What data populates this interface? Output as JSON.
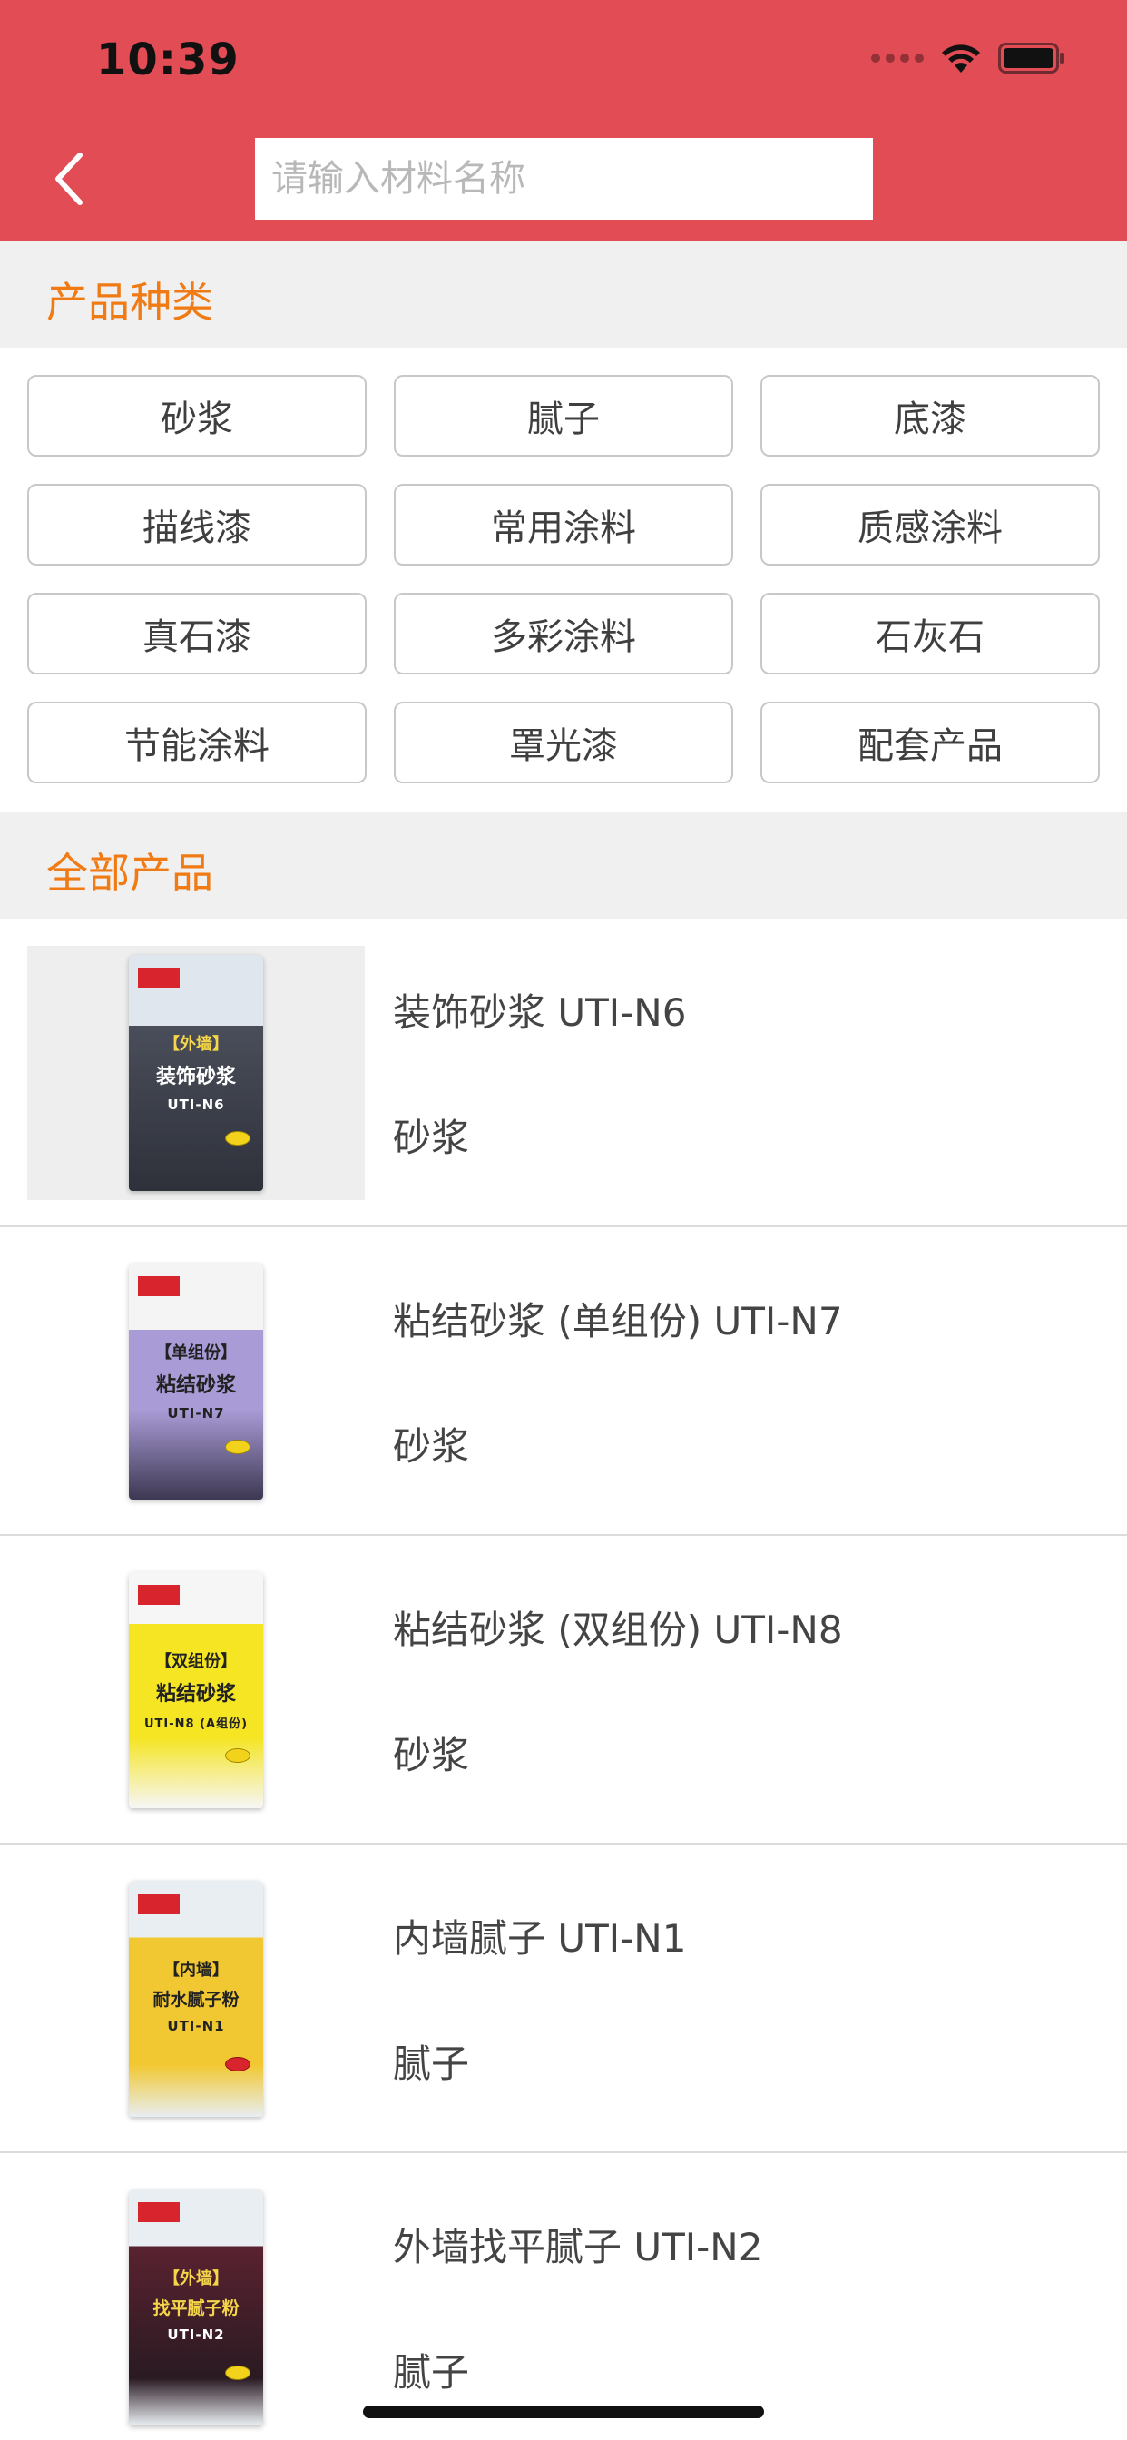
{
  "status_bar": {
    "time": "10:39"
  },
  "header": {
    "search_placeholder": "请输入材料名称"
  },
  "categories_section": {
    "title": "产品种类",
    "items": [
      "砂浆",
      "腻子",
      "底漆",
      "描线漆",
      "常用涂料",
      "质感涂料",
      "真石漆",
      "多彩涂料",
      "石灰石",
      "节能涂料",
      "罩光漆",
      "配套产品"
    ]
  },
  "products_section": {
    "title": "全部产品",
    "items": [
      {
        "name": "装饰砂浆 UTI-N6",
        "category": "砂浆",
        "package": {
          "tag": "【外墙】",
          "name": "装饰砂浆",
          "code": "UTI-N6",
          "color": "#4a4e5a",
          "text_color": "#ffffff"
        }
      },
      {
        "name": "粘结砂浆 (单组份) UTI-N7",
        "category": "砂浆",
        "package": {
          "tag": "【单组份】",
          "name": "粘结砂浆",
          "code": "UTI-N7",
          "color": "#a99bd6",
          "text_color": "#222222"
        }
      },
      {
        "name": "粘结砂浆 (双组份) UTI-N8",
        "category": "砂浆",
        "package": {
          "tag": "【双组份】",
          "name": "粘结砂浆",
          "code": "UTI-N8 (A组份)",
          "color": "#f5e523",
          "text_color": "#222222"
        }
      },
      {
        "name": "内墙腻子 UTI-N1",
        "category": "腻子",
        "package": {
          "tag": "【内墙】",
          "name": "耐水腻子粉",
          "code": "UTI-N1",
          "color": "#f2c832",
          "text_color": "#222222"
        }
      },
      {
        "name": "外墙找平腻子 UTI-N2",
        "category": "腻子",
        "package": {
          "tag": "【外墙】",
          "name": "找平腻子粉",
          "code": "UTI-N2",
          "color": "#5a2230",
          "text_color": "#f5d64a"
        }
      }
    ]
  },
  "colors": {
    "header_bg": "#e24c54",
    "section_title": "#f07a14",
    "section_bg": "#f0f0f0"
  },
  "icons": {
    "back": "chevron-left-icon",
    "wifi": "wifi-icon",
    "battery": "battery-icon",
    "signal": "signal-icon"
  }
}
